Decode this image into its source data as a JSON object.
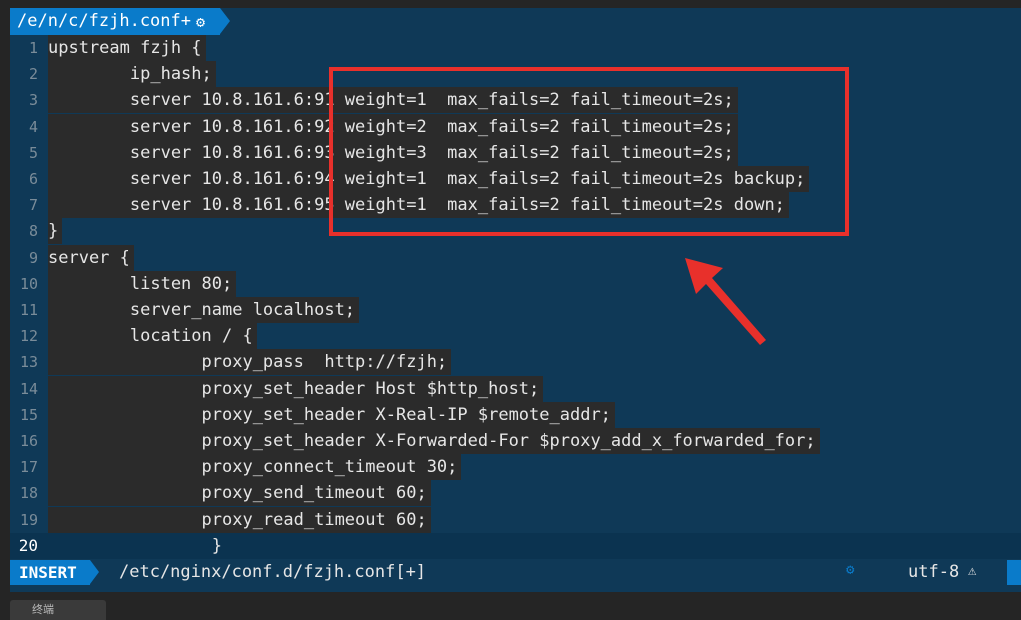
{
  "tab": {
    "title": "/e/n/c/fzjh.conf+",
    "gear_icon": "gear-icon"
  },
  "code_lines": [
    {
      "num": "1",
      "text": "upstream fzjh {"
    },
    {
      "num": "2",
      "text": "        ip_hash;"
    },
    {
      "num": "3",
      "text": "        server 10.8.161.6:91 weight=1  max_fails=2 fail_timeout=2s;"
    },
    {
      "num": "4",
      "text": "        server 10.8.161.6:92 weight=2  max_fails=2 fail_timeout=2s;"
    },
    {
      "num": "5",
      "text": "        server 10.8.161.6:93 weight=3  max_fails=2 fail_timeout=2s;"
    },
    {
      "num": "6",
      "text": "        server 10.8.161.6:94 weight=1  max_fails=2 fail_timeout=2s backup;"
    },
    {
      "num": "7",
      "text": "        server 10.8.161.6:95 weight=1  max_fails=2 fail_timeout=2s down;"
    },
    {
      "num": "8",
      "text": "}"
    },
    {
      "num": "9",
      "text": "server {"
    },
    {
      "num": "10",
      "text": "        listen 80;"
    },
    {
      "num": "11",
      "text": "        server_name localhost;"
    },
    {
      "num": "12",
      "text": "        location / {"
    },
    {
      "num": "13",
      "text": "               proxy_pass  http://fzjh;"
    },
    {
      "num": "14",
      "text": "               proxy_set_header Host $http_host;"
    },
    {
      "num": "15",
      "text": "               proxy_set_header X-Real-IP $remote_addr;"
    },
    {
      "num": "16",
      "text": "               proxy_set_header X-Forwarded-For $proxy_add_x_forwarded_for;"
    },
    {
      "num": "17",
      "text": "               proxy_connect_timeout 30;"
    },
    {
      "num": "18",
      "text": "               proxy_send_timeout 60;"
    },
    {
      "num": "19",
      "text": "               proxy_read_timeout 60;"
    },
    {
      "num": "20",
      "text": "                }"
    }
  ],
  "cursor_line": "20",
  "status": {
    "mode": "INSERT",
    "file_path": "/etc/nginx/conf.d/fzjh.conf[+]",
    "encoding": "utf-8",
    "warning_icon": "warning-icon",
    "gear_icon": "gear-icon"
  },
  "bottom_tab": {
    "text": "终端"
  },
  "colors": {
    "editor_bg": "#0f3957",
    "accent": "#0a7bca",
    "text": "#e6e6e6",
    "annotation": "#e8302b"
  }
}
